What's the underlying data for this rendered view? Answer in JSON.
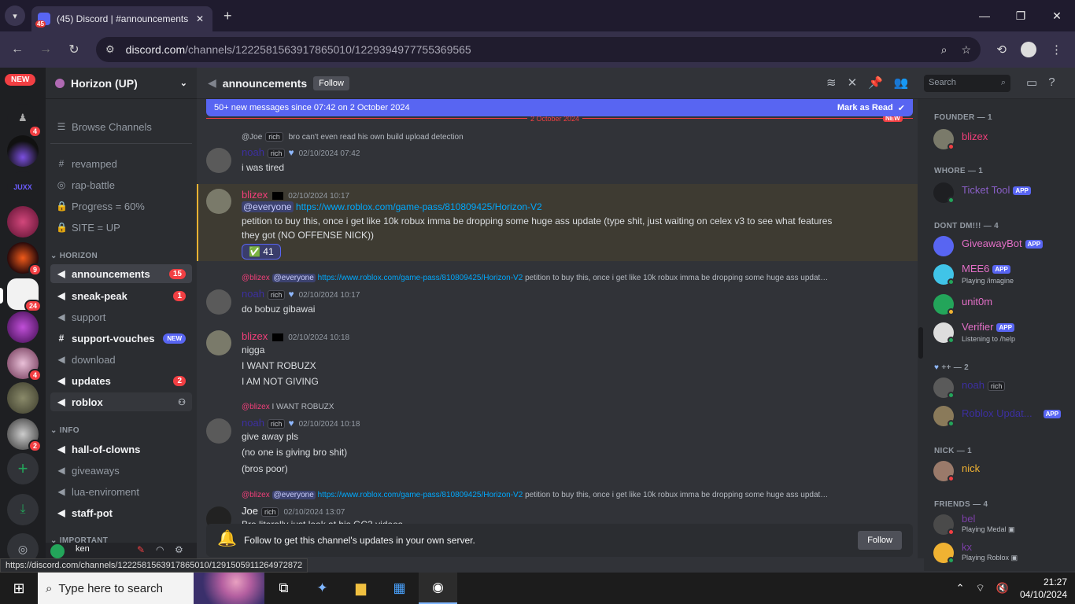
{
  "browser": {
    "tab_badge": "45",
    "tab_title": "(45) Discord | #announcements",
    "url_host": "discord.com",
    "url_path": "/channels/1222581563917865010/1229394977755369565",
    "status_url": "https://discord.com/channels/1222581563917865010/1291505911264972872"
  },
  "rail": {
    "new_label": "NEW",
    "servers": [
      {
        "badge": "4"
      },
      {
        "badge": ""
      },
      {
        "badge": "",
        "label": "JUXX"
      },
      {
        "badge": ""
      },
      {
        "badge": "9"
      },
      {
        "badge": "24"
      },
      {
        "badge": ""
      },
      {
        "badge": "4"
      },
      {
        "badge": ""
      },
      {
        "badge": "2"
      }
    ]
  },
  "guild": {
    "name": "Horizon (UP)"
  },
  "channels": {
    "browse": "Browse Channels",
    "top": [
      {
        "label": "revamped",
        "icon": "#"
      },
      {
        "label": "rap-battle",
        "icon": "◎"
      },
      {
        "label": "Progress = 60%",
        "icon": "🔒"
      },
      {
        "label": "SITE = UP",
        "icon": "🔒"
      }
    ],
    "cat_horizon": "HORIZON",
    "horizon": [
      {
        "label": "announcements",
        "badge": "15"
      },
      {
        "label": "sneak-peak",
        "badge": "1"
      },
      {
        "label": "support",
        "badge": ""
      },
      {
        "label": "support-vouches",
        "badge": "NEW"
      },
      {
        "label": "download",
        "badge": ""
      },
      {
        "label": "updates",
        "badge": "2"
      },
      {
        "label": "roblox",
        "badge": ""
      }
    ],
    "cat_info": "INFO",
    "info": [
      {
        "label": "hall-of-clowns"
      },
      {
        "label": "giveaways"
      },
      {
        "label": "lua-enviroment"
      },
      {
        "label": "staff-pot"
      }
    ],
    "cat_important": "IMPORTANT",
    "username": "ken"
  },
  "header": {
    "channel": "announcements",
    "follow": "Follow",
    "search_placeholder": "Search"
  },
  "chat": {
    "newbar_text": "50+ new messages since 07:42 on 2 October 2024",
    "mark_read": "Mark as Read",
    "date_sep": "2 October 2024",
    "new_tag": "NEW",
    "messages": [
      {
        "reply_user": "@Joe",
        "reply_tag": "rich",
        "reply_text": "bro can't even read his own build upload detection",
        "user": "noah",
        "tag": "rich",
        "time": "02/10/2024 07:42",
        "lines": [
          "i was tired"
        ]
      },
      {
        "user": "blizex",
        "time": "02/10/2024 10:17",
        "mention": "@everyone",
        "link": "https://www.roblox.com/game-pass/810809425/Horizon-V2",
        "lines": [
          "petition to buy this, once i get like 10k robux imma be dropping some huge ass update (type shit, just waiting on celex v3 to see what features",
          "they got (NO OFFENSE NICK))"
        ],
        "reaction": "41"
      },
      {
        "reply_user": "@blizex",
        "reply_mention": "@everyone",
        "reply_link": "https://www.roblox.com/game-pass/810809425/Horizon-V2",
        "reply_text": "petition to buy this, once i get like 10k robux imma be dropping some huge ass updat…",
        "user": "noah",
        "tag": "rich",
        "time": "02/10/2024 10:17",
        "lines": [
          "do bobuz gibawai"
        ]
      },
      {
        "user": "blizex",
        "time": "02/10/2024 10:18",
        "lines": [
          "nigga",
          "I WANT ROBUZX",
          "I AM NOT GIVING"
        ]
      },
      {
        "reply_user": "@blizex",
        "reply_text": "I WANT ROBUZX",
        "user": "noah",
        "tag": "rich",
        "time": "02/10/2024 10:18",
        "lines": [
          "give away pls",
          "(no one is giving bro shit)",
          "(bros poor)"
        ]
      },
      {
        "reply_user": "@blizex",
        "reply_mention": "@everyone",
        "reply_link": "https://www.roblox.com/game-pass/810809425/Horizon-V2",
        "reply_text": "petition to buy this, once i get like 10k robux imma be dropping some huge ass updat…",
        "user": "Joe",
        "tag": "rich",
        "time": "02/10/2024 13:07",
        "lines": [
          "Bro literally just look at his GC3 videos"
        ]
      }
    ],
    "followbar_text": "Follow to get this channel's updates in your own server.",
    "followbar_btn": "Follow"
  },
  "members": {
    "roles": [
      {
        "name": "FOUNDER — 1"
      },
      {
        "name": "WHORE — 1"
      },
      {
        "name": "DONT DM!!! — 4"
      },
      {
        "name": "++ — 2"
      },
      {
        "name": "NICK — 1"
      },
      {
        "name": "FRIENDS — 4"
      }
    ],
    "list": [
      {
        "name": "blizex",
        "status": "",
        "color": "#f23f7a"
      },
      {
        "name": "Ticket Tool",
        "status": "",
        "color": "#8a5fc7",
        "app": "APP"
      },
      {
        "name": "GiveawayBot",
        "status": "",
        "color": "#e36fc7",
        "app": "APP"
      },
      {
        "name": "MEE6",
        "status": "Playing /imagine",
        "color": "#e36fc7",
        "app": "APP"
      },
      {
        "name": "unit0m",
        "status": "",
        "color": "#e36fc7"
      },
      {
        "name": "Verifier",
        "status": "Listening to /help",
        "color": "#e36fc7",
        "app": "APP"
      },
      {
        "name": "noah",
        "status": "",
        "color": "#3c2fa0",
        "tag": "rich"
      },
      {
        "name": "Roblox Updat...",
        "status": "",
        "color": "#3c2fa0",
        "app": "APP"
      },
      {
        "name": "nick",
        "status": "",
        "color": "#f0b232"
      },
      {
        "name": "bel",
        "status": "Playing Medal",
        "color": "#7c3fa8"
      },
      {
        "name": "kx",
        "status": "Playing Roblox",
        "color": "#7c3fa8"
      }
    ]
  },
  "taskbar": {
    "search": "Type here to search",
    "time": "21:27",
    "date": "04/10/2024"
  },
  "colors": {
    "blurple": "#5865f2",
    "red": "#f23f43",
    "link": "#00a8fc"
  }
}
